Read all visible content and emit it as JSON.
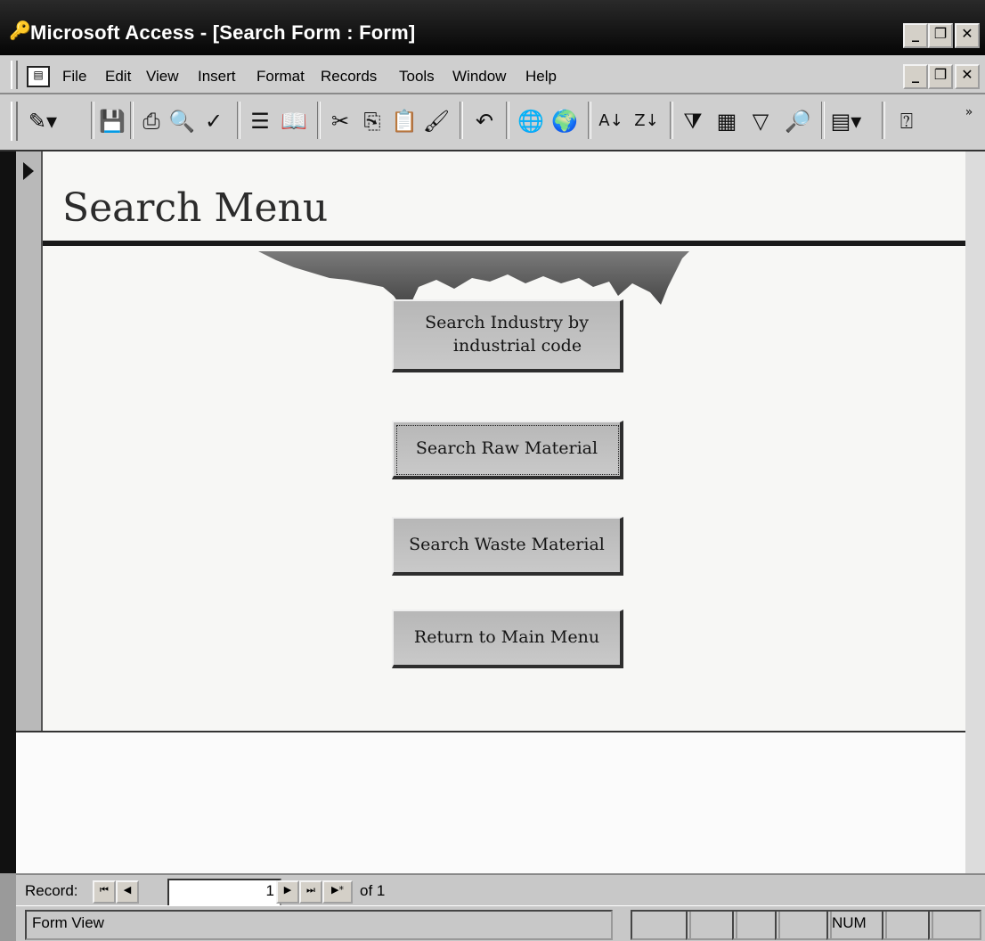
{
  "window": {
    "title": "Microsoft Access - [Search Form : Form]",
    "app_icon": "key-icon",
    "controls": [
      "minimize-icon",
      "restore-icon",
      "close-icon"
    ]
  },
  "menubar": {
    "items": [
      "File",
      "Edit",
      "View",
      "Insert",
      "Format",
      "Records",
      "Tools",
      "Window",
      "Help"
    ],
    "doc_controls": [
      "minimize-icon",
      "restore-icon",
      "close-icon"
    ]
  },
  "toolbar": {
    "icons": [
      "view-icon",
      "save-icon",
      "print-icon",
      "print-preview-icon",
      "spelling-icon",
      "format-painter-icon",
      "properties-icon",
      "cut-icon",
      "copy-icon",
      "paste-icon",
      "brush-icon",
      "undo-icon",
      "hyperlink-icon",
      "web-icon",
      "sort-ascending-icon",
      "sort-descending-icon",
      "filter-by-selection-icon",
      "filter-by-form-icon",
      "apply-filter-icon",
      "find-icon",
      "new-object-icon",
      "help-icon"
    ]
  },
  "form": {
    "heading": "Search Menu",
    "buttons": [
      {
        "line1": "Search Industry by",
        "line2": "industrial code"
      },
      {
        "label": "Search Raw Material"
      },
      {
        "label": "Search Waste Material"
      },
      {
        "label": "Return to Main Menu"
      }
    ]
  },
  "record_nav": {
    "label": "Record:",
    "current": "1",
    "of_text": "of 1"
  },
  "statusbar": {
    "text": "Form View",
    "num": "NUM"
  }
}
